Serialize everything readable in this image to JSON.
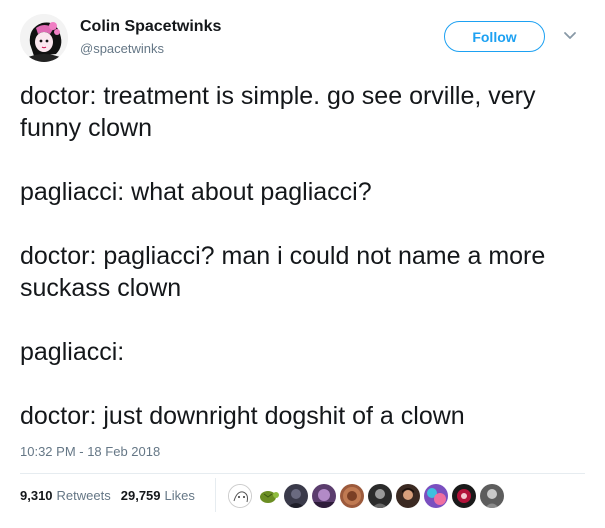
{
  "author": {
    "display_name": "Colin Spacetwinks",
    "handle": "@spacetwinks",
    "avatar_icon": "anime-character-avatar-icon"
  },
  "follow_button": {
    "label": "Follow"
  },
  "menu_caret": {
    "icon": "chevron-down-icon"
  },
  "tweet": {
    "paragraphs": [
      "doctor: treatment is simple. go see orville, very funny clown",
      "pagliacci: what about pagliacci?",
      "doctor: pagliacci? man i could not name a more suckass clown",
      "pagliacci:",
      "doctor: just downright dogshit of a clown"
    ],
    "timestamp": "10:32 PM - 18 Feb 2018"
  },
  "stats": {
    "retweets_count": "9,310",
    "retweets_label": "Retweets",
    "likes_count": "29,759",
    "likes_label": "Likes"
  },
  "liker_avatars": [
    {
      "name": "sketch-avatar",
      "color": "#ffffff"
    },
    {
      "name": "turtle-avatar",
      "color": "#6b8e23"
    },
    {
      "name": "dark-avatar",
      "color": "#3a3a4a"
    },
    {
      "name": "purple-avatar",
      "color": "#5b3d6e"
    },
    {
      "name": "copper-avatar",
      "color": "#9c5a3c"
    },
    {
      "name": "mono-avatar",
      "color": "#2b2b2b"
    },
    {
      "name": "portrait-avatar",
      "color": "#3b2a22"
    },
    {
      "name": "colorful-avatar",
      "color": "#7a4fbf"
    },
    {
      "name": "red-avatar",
      "color": "#b3123a"
    },
    {
      "name": "gray-avatar",
      "color": "#5d5d5d"
    }
  ],
  "colors": {
    "accent": "#1da1f2",
    "text": "#14171a",
    "secondary_text": "#657786",
    "divider": "#e6ecf0"
  }
}
